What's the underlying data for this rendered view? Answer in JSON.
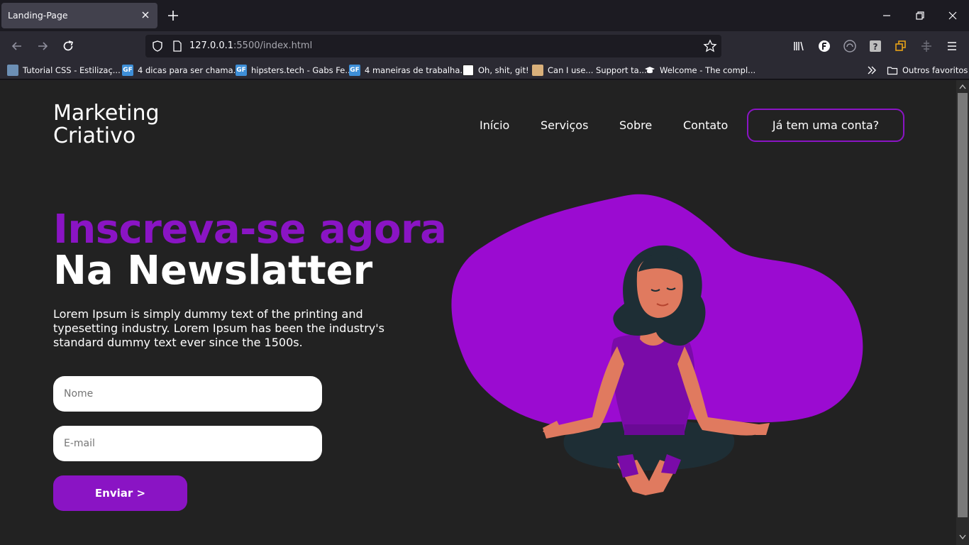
{
  "browser": {
    "tab_title": "Landing-Page",
    "url_host": "127.0.0.1",
    "url_rest": ":5500/index.html",
    "bookmarks": [
      {
        "label": "Tutorial CSS - Estilizaç..."
      },
      {
        "label": "4 dicas para ser chama..."
      },
      {
        "label": "hipsters.tech - Gabs Fe..."
      },
      {
        "label": "4 maneiras de trabalha..."
      },
      {
        "label": "Oh, shit, git!"
      },
      {
        "label": "Can I use... Support ta..."
      },
      {
        "label": "Welcome - The compl..."
      }
    ],
    "other_bookmarks": "Outros favoritos"
  },
  "site": {
    "logo_line1": "Marketing",
    "logo_line2": "Criativo",
    "menu": [
      "Início",
      "Serviços",
      "Sobre",
      "Contato"
    ],
    "login_label": "Já tem uma conta?",
    "headline_purple": "Inscreva-se agora",
    "headline_white": "Na Newslatter",
    "lede": "Lorem Ipsum is simply dummy text of the printing and typesetting industry. Lorem Ipsum has been the industry's standard dummy text ever since the 1500s.",
    "name_placeholder": "Nome",
    "email_placeholder": "E-mail",
    "send_label": "Enviar >"
  },
  "colors": {
    "accent": "#8a14c4",
    "blob": "#9b0bd1",
    "page_bg": "#222222"
  }
}
